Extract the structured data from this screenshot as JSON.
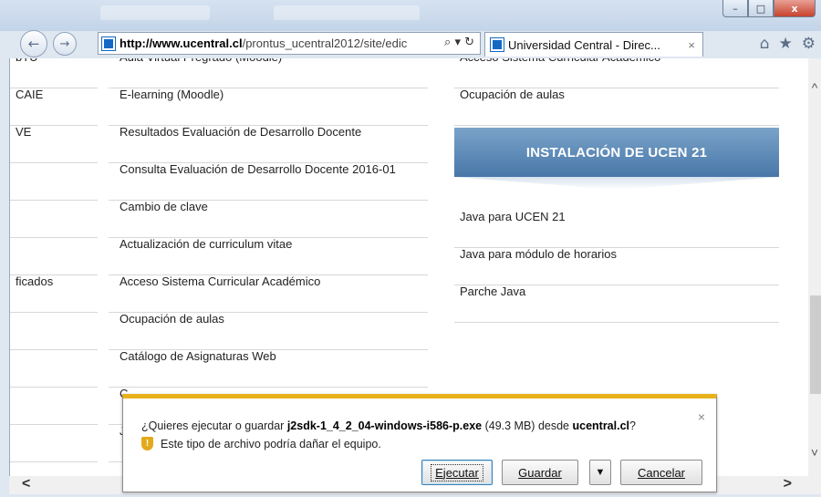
{
  "browser": {
    "address_domain": "http://www.ucentral.cl",
    "address_path": "/prontus_ucentral2012/site/edic",
    "address_tools": "⌕ ▾ ↻",
    "tab_title": "Universidad Central - Direc...",
    "tab_close": "×",
    "back": "←",
    "forward": "→",
    "home": "⌂",
    "favorites": "★",
    "tools": "⚙",
    "window": {
      "minimize": "–",
      "maximize": "□",
      "close": "x"
    }
  },
  "left_fragments": [
    {
      "text": "bTU"
    },
    {
      "text": "CAIE"
    },
    {
      "text": "VE"
    },
    {
      "text": ""
    },
    {
      "text": ""
    },
    {
      "text": ""
    },
    {
      "text": "ficados"
    },
    {
      "text": ""
    },
    {
      "text": ""
    },
    {
      "text": ""
    },
    {
      "text": ""
    }
  ],
  "middle_links": [
    {
      "text": "Aula Virtual Pregrado (Moodle)"
    },
    {
      "text": "E-learning (Moodle)"
    },
    {
      "text": "Resultados Evaluación de Desarrollo Docente"
    },
    {
      "text": "Consulta Evaluación de Desarrollo Docente 2016-01"
    },
    {
      "text": "Cambio de clave"
    },
    {
      "text": "Actualización de curriculum vitae"
    },
    {
      "text": "Acceso Sistema Curricular Académico"
    },
    {
      "text": "Ocupación de aulas"
    },
    {
      "text": "Catálogo de Asignaturas Web"
    },
    {
      "text": "C"
    },
    {
      "text": "J"
    }
  ],
  "right_links_top": [
    {
      "text": "Acceso Sistema Curricular Académico"
    },
    {
      "text": "Ocupación de aulas"
    }
  ],
  "banner": {
    "title": "INSTALACIÓN DE UCEN 21",
    "color": "#5f8cbb"
  },
  "right_links_bottom": [
    {
      "text": "Java para UCEN 21"
    },
    {
      "text": "Java para módulo de horarios"
    },
    {
      "text": "Parche Java"
    }
  ],
  "download": {
    "prompt_before": "¿Quieres ejecutar o guardar ",
    "filename": "j2sdk-1_4_2_04-windows-i586-p.exe",
    "size": " (49.3 MB) desde ",
    "source": "ucentral.cl",
    "prompt_after": "?",
    "warning": "Este tipo de archivo podría dañar el equipo.",
    "close": "×",
    "run_label": "Ejecutar",
    "save_label": "Guardar",
    "save_menu": "▼",
    "cancel_label": "Cancelar",
    "accent_color": "#e8b21c"
  },
  "scroll": {
    "up": "^",
    "down": "˅",
    "left": "<",
    "right": ">"
  }
}
